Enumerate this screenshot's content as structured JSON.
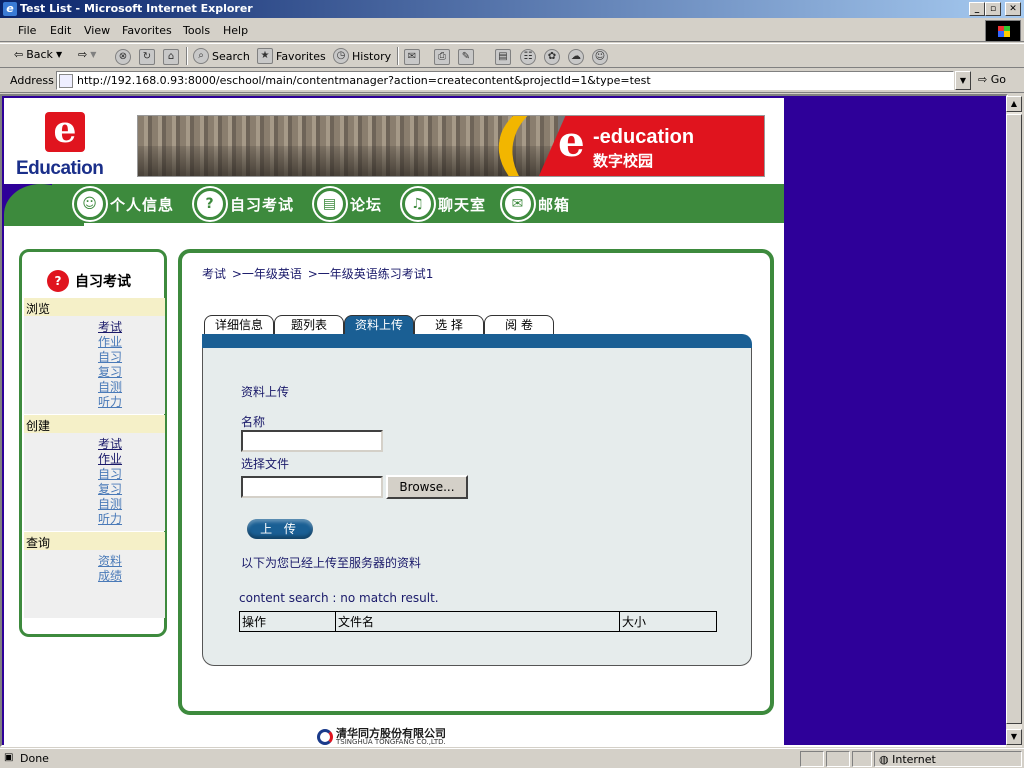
{
  "window": {
    "title": "Test List - Microsoft Internet Explorer",
    "min": "_",
    "max": "▫",
    "close": "✕"
  },
  "menu": {
    "file": "File",
    "edit": "Edit",
    "view": "View",
    "favorites": "Favorites",
    "tools": "Tools",
    "help": "Help"
  },
  "toolbar": {
    "back": "Back",
    "search": "Search",
    "favorites": "Favorites",
    "history": "History"
  },
  "address": {
    "label": "Address",
    "url": "http://192.168.0.93:8000/eschool/main/contentmanager?action=createcontent&projectId=1&type=test",
    "go": "Go"
  },
  "header": {
    "logo_text": "Education",
    "banner_small": "-education",
    "banner_big": "e",
    "banner_cn": "数字校园"
  },
  "nav": {
    "items": [
      {
        "label": "个人信息",
        "icon": "person-icon"
      },
      {
        "label": "自习考试",
        "icon": "exam-icon"
      },
      {
        "label": "论坛",
        "icon": "forum-icon"
      },
      {
        "label": "聊天室",
        "icon": "microphone-icon"
      },
      {
        "label": "邮箱",
        "icon": "mail-icon"
      }
    ]
  },
  "sidebar": {
    "title": "自习考试",
    "sections": [
      {
        "label": "浏览",
        "links": [
          "考试",
          "作业",
          "自习",
          "复习",
          "自测",
          "听力"
        ]
      },
      {
        "label": "创建",
        "links": [
          "考试",
          "作业",
          "自习",
          "复习",
          "自测",
          "听力"
        ]
      },
      {
        "label": "查询",
        "links": [
          "资料",
          "成绩"
        ]
      }
    ]
  },
  "breadcrumb": {
    "part1": "考试",
    "part2": ">一年级英语",
    "part3": ">一年级英语练习考试1"
  },
  "tabs": [
    {
      "label": "详细信息",
      "active": false
    },
    {
      "label": "题列表",
      "active": false
    },
    {
      "label": "资料上传",
      "active": true
    },
    {
      "label": "选 择",
      "active": false
    },
    {
      "label": "阅 卷",
      "active": false
    }
  ],
  "form": {
    "heading": "资料上传",
    "name_label": "名称",
    "name_value": "",
    "file_label": "选择文件",
    "file_value": "",
    "browse_label": "Browse...",
    "upload_label": "上 传",
    "uploaded_text": "以下为您已经上传至服务器的资料",
    "search_msg": "content search : no match result."
  },
  "file_table": {
    "headers": [
      "操作",
      "文件名",
      "大小"
    ]
  },
  "footer": {
    "company_cn": "清华同方股份有限公司",
    "company_en": "TSINGHUA TONGFANG CO.,LTD."
  },
  "status": {
    "text": "Done",
    "zone": "Internet"
  },
  "colors": {
    "page_bg": "#2e0099",
    "green": "#3d8a3d",
    "tab_blue": "#1a5f94",
    "brand_red": "#e0141e"
  }
}
